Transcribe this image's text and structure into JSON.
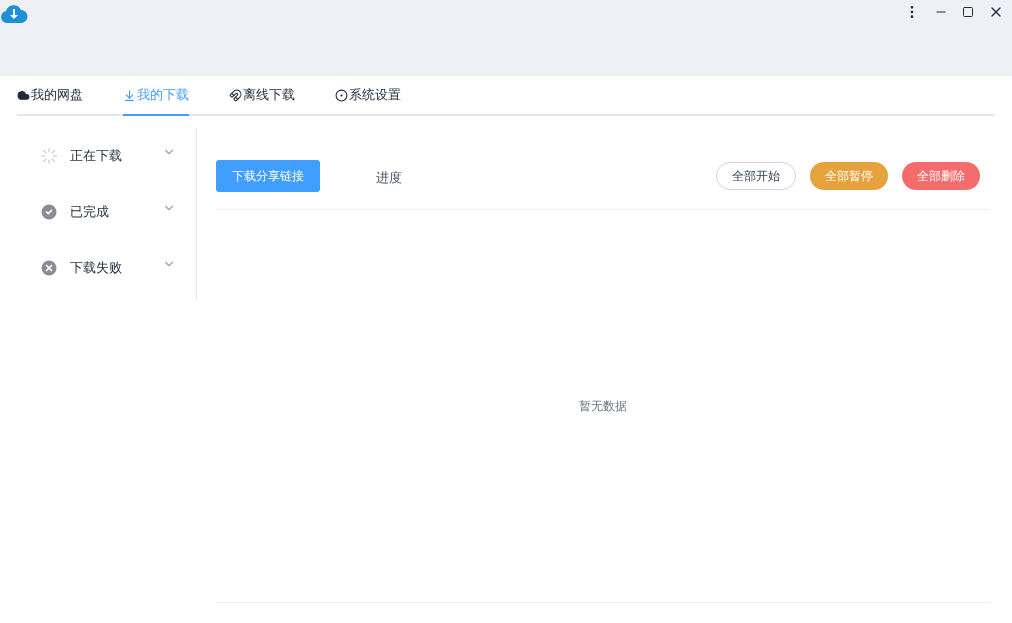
{
  "tabs": [
    {
      "label": "我的网盘",
      "kind": "cloud",
      "selected": false
    },
    {
      "label": "我的下载",
      "kind": "download",
      "selected": true
    },
    {
      "label": "离线下载",
      "kind": "magnet",
      "selected": false
    },
    {
      "label": "系统设置",
      "kind": "gear",
      "selected": false
    }
  ],
  "sidebar": {
    "items": [
      {
        "label": "正在下载",
        "kind": "loading"
      },
      {
        "label": "已完成",
        "kind": "done"
      },
      {
        "label": "下载失败",
        "kind": "failed"
      }
    ]
  },
  "toolbar": {
    "primary_button": "下载分享链接",
    "progress_label": "进度",
    "buttons": [
      {
        "label": "全部开始",
        "kind": "outline"
      },
      {
        "label": "全部暂停",
        "kind": "warning"
      },
      {
        "label": "全部删除",
        "kind": "danger"
      }
    ]
  },
  "empty_text": "暂无数据"
}
